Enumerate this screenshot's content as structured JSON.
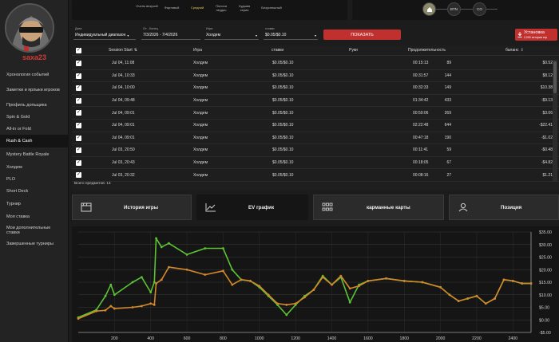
{
  "user": {
    "name": "saxa23"
  },
  "sidebar": {
    "items": [
      {
        "label": "Хронология событий"
      },
      {
        "label": "Заметки и ярлыки игроков"
      },
      {
        "label": "Профиль допьщика"
      },
      {
        "label": "Spin & Gold"
      },
      {
        "label": "All-in or Fold"
      },
      {
        "label": "Rush & Cash"
      },
      {
        "label": "Mystery Battle Royale"
      },
      {
        "label": "Холдем"
      },
      {
        "label": "PLO"
      },
      {
        "label": "Short Deck"
      },
      {
        "label": "Турнир"
      },
      {
        "label": "Моя ставка"
      },
      {
        "label": "Мои дополнительные ставки"
      },
      {
        "label": "Завершенные турниры"
      }
    ]
  },
  "top_headers": [
    {
      "label": "Очень везучий"
    },
    {
      "label": "Фартовый"
    },
    {
      "label": "Средний"
    },
    {
      "label": "Полоса неудач"
    },
    {
      "label": "Худшая серия"
    },
    {
      "label": "Безуспешный"
    }
  ],
  "positions": {
    "items": [
      "BTN",
      "CO"
    ]
  },
  "filters": {
    "date_label": "Дата",
    "date_value": "Индивидуальный диапазон",
    "range_label": "От - Конец",
    "range_value": "7/3/2026 - 7/4/2026",
    "game_label": "Игра",
    "game_value": "Холдем",
    "stakes_label": "ставки",
    "stakes_value": "$0.05/$0.10",
    "show_button": "ПОКАЗАТЬ"
  },
  "install": {
    "title": "Установка",
    "subtitle": "2,000 истории игр"
  },
  "table": {
    "columns": [
      "Session Start",
      "Игра",
      "ставки",
      "Руки",
      "Продолжительность",
      "баланс"
    ],
    "rows": [
      {
        "start": "Jul 04, 11:08",
        "game": "Холдем",
        "stakes": "$0.05/$0.10",
        "hands": "89",
        "duration": "00:15:13",
        "balance": "$0.52"
      },
      {
        "start": "Jul 04, 10:33",
        "game": "Холдем",
        "stakes": "$0.05/$0.10",
        "hands": "144",
        "duration": "00:31:57",
        "balance": "$8.12"
      },
      {
        "start": "Jul 04, 10:00",
        "game": "Холдем",
        "stakes": "$0.05/$0.10",
        "hands": "149",
        "duration": "00:32:33",
        "balance": "$10.38"
      },
      {
        "start": "Jul 04, 09:48",
        "game": "Холдем",
        "stakes": "$0.05/$0.10",
        "hands": "433",
        "duration": "01:34:42",
        "balance": "-$9.13"
      },
      {
        "start": "Jul 04, 09:01",
        "game": "Холдем",
        "stakes": "$0.05/$0.10",
        "hands": "269",
        "duration": "00:59:06",
        "balance": "$3.06"
      },
      {
        "start": "Jul 04, 09:01",
        "game": "Холдем",
        "stakes": "$0.05/$0.10",
        "hands": "644",
        "duration": "02:22:48",
        "balance": "-$22.41"
      },
      {
        "start": "Jul 04, 09:01",
        "game": "Холдем",
        "stakes": "$0.05/$0.10",
        "hands": "190",
        "duration": "00:47:18",
        "balance": "-$1.02"
      },
      {
        "start": "Jul 03, 20:50",
        "game": "Холдем",
        "stakes": "$0.05/$0.10",
        "hands": "59",
        "duration": "00:11:41",
        "balance": "-$0.48"
      },
      {
        "start": "Jul 03, 20:43",
        "game": "Холдем",
        "stakes": "$0.05/$0.10",
        "hands": "67",
        "duration": "00:18:05",
        "balance": "-$4.82"
      },
      {
        "start": "Jul 03, 20:32",
        "game": "Холдем",
        "stakes": "$0.05/$0.10",
        "hands": "27",
        "duration": "00:08:16",
        "balance": "$1.21"
      }
    ],
    "footer": "Всего предметов: 14"
  },
  "tabs": [
    {
      "label": "История игры",
      "icon": "clapper-icon"
    },
    {
      "label": "EV график",
      "icon": "line-chart-icon"
    },
    {
      "label": "карманные карты",
      "icon": "grid-icon"
    },
    {
      "label": "Позиция",
      "icon": "user-badge-icon"
    }
  ],
  "colors": {
    "accent": "#c0302e",
    "ev_line": "#d4882a",
    "net_line": "#5cc332"
  },
  "chart_data": {
    "type": "line",
    "x": [
      0,
      100,
      150,
      180,
      200,
      300,
      350,
      400,
      420,
      430,
      460,
      500,
      600,
      700,
      800,
      850,
      900,
      950,
      1000,
      1050,
      1100,
      1150,
      1200,
      1250,
      1300,
      1350,
      1400,
      1450,
      1500,
      1550,
      1600,
      1700,
      1800,
      1900,
      2000,
      2050,
      2100,
      2150,
      2200,
      2250,
      2300,
      2350,
      2400,
      2450,
      2500
    ],
    "series": [
      {
        "values": [
          0.5,
          3.5,
          3.8,
          5.5,
          4.5,
          5.0,
          5.5,
          6.5,
          6.0,
          14.5,
          16.0,
          21.0,
          20.0,
          18.0,
          19.5,
          14.0,
          16.0,
          15.5,
          13.5,
          10.0,
          6.5,
          6.0,
          6.5,
          9.0,
          12.0,
          17.0,
          14.0,
          17.5,
          12.5,
          13.5,
          15.5,
          16.5,
          15.5,
          15.0,
          13.0,
          10.0,
          7.5,
          8.5,
          9.5,
          6.5,
          8.5,
          16.0,
          15.5,
          14.5,
          14.5
        ]
      },
      {
        "values": [
          1.0,
          4.0,
          9.5,
          14.0,
          10.0,
          15.0,
          17.0,
          11.0,
          15.0,
          32.5,
          29.0,
          30.5,
          26.0,
          28.5,
          28.5,
          20.0,
          16.0,
          15.5,
          13.0,
          9.5,
          6.0,
          2.0,
          6.0,
          9.5,
          12.0,
          17.5,
          14.0,
          17.0,
          7.0,
          14.0,
          15.5,
          16.5,
          15.5,
          15.0,
          13.0,
          10.0,
          7.5,
          8.5,
          9.5,
          6.5,
          8.5,
          16.0,
          15.5,
          14.5,
          14.5
        ]
      }
    ],
    "x_ticks": [
      200,
      400,
      600,
      800,
      1000,
      1200,
      1400,
      1600,
      1800,
      2000,
      2200,
      2400
    ],
    "y_ticks": [
      "$35.00",
      "$30.00",
      "$25.00",
      "$20.00",
      "$15.00",
      "$10.00",
      "$5.00",
      "$0.00",
      "-$5.00"
    ],
    "ylim": [
      -5,
      35
    ],
    "xlim": [
      0,
      2500
    ],
    "grid": true
  }
}
